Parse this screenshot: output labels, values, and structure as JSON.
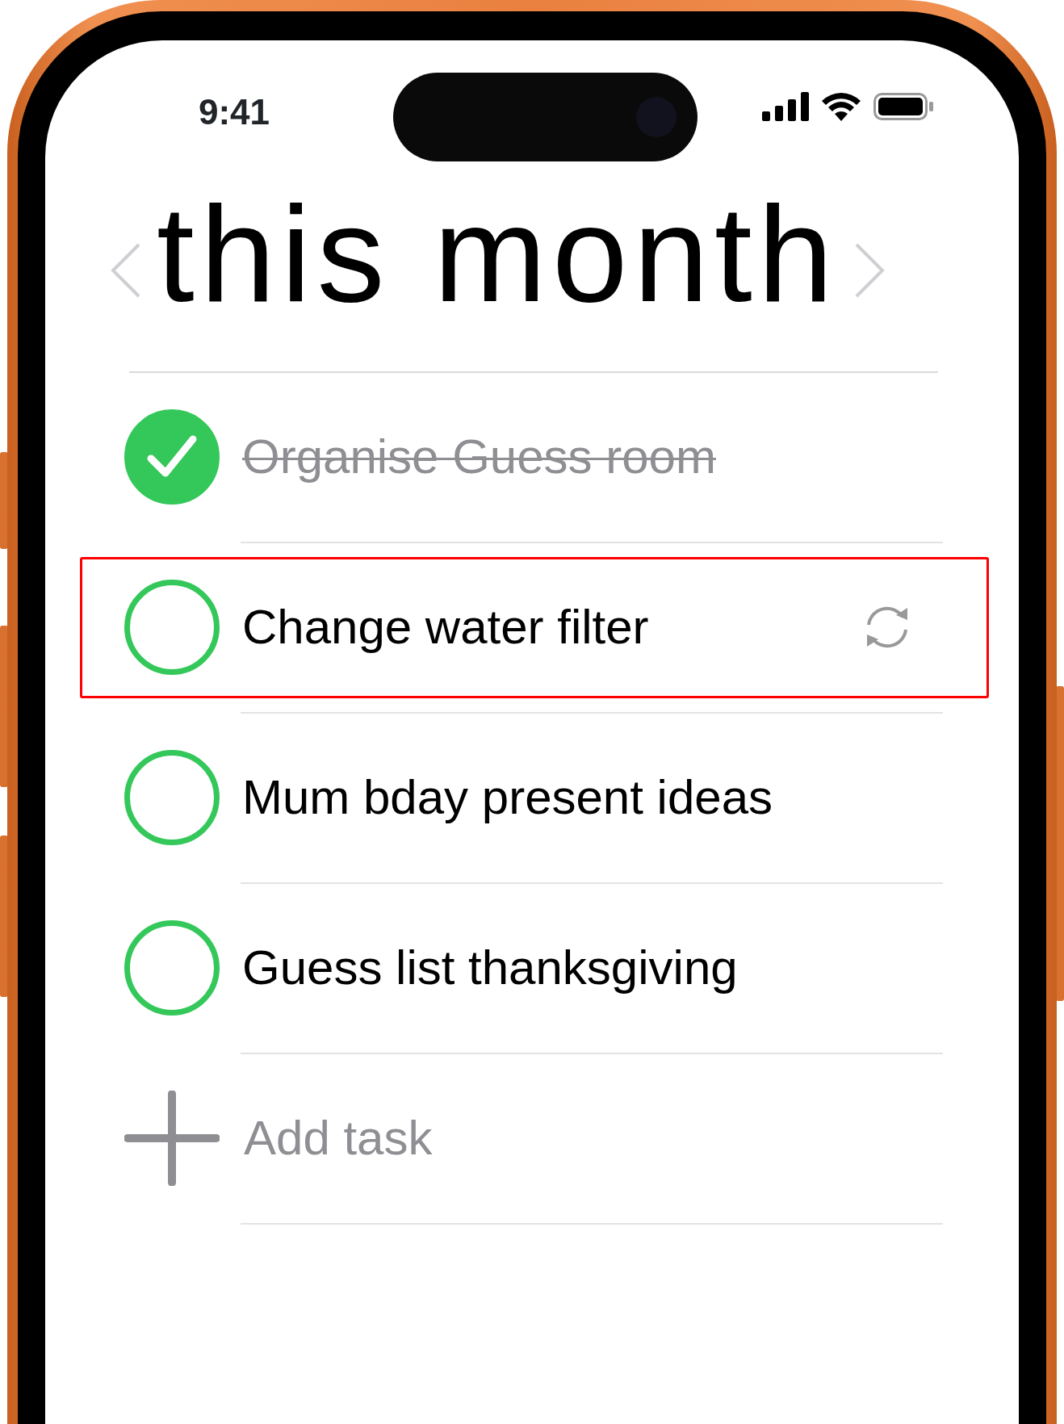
{
  "status_bar": {
    "time": "9:41"
  },
  "header": {
    "title": "this month"
  },
  "tasks": [
    {
      "text": "Organise Guess room",
      "checked": true,
      "repeat": false,
      "highlighted": false
    },
    {
      "text": "Change water filter",
      "checked": false,
      "repeat": true,
      "highlighted": true
    },
    {
      "text": "Mum bday present ideas",
      "checked": false,
      "repeat": false,
      "highlighted": false
    },
    {
      "text": "Guess list thanksgiving",
      "checked": false,
      "repeat": false,
      "highlighted": false
    }
  ],
  "add_task": {
    "placeholder": "Add task"
  }
}
